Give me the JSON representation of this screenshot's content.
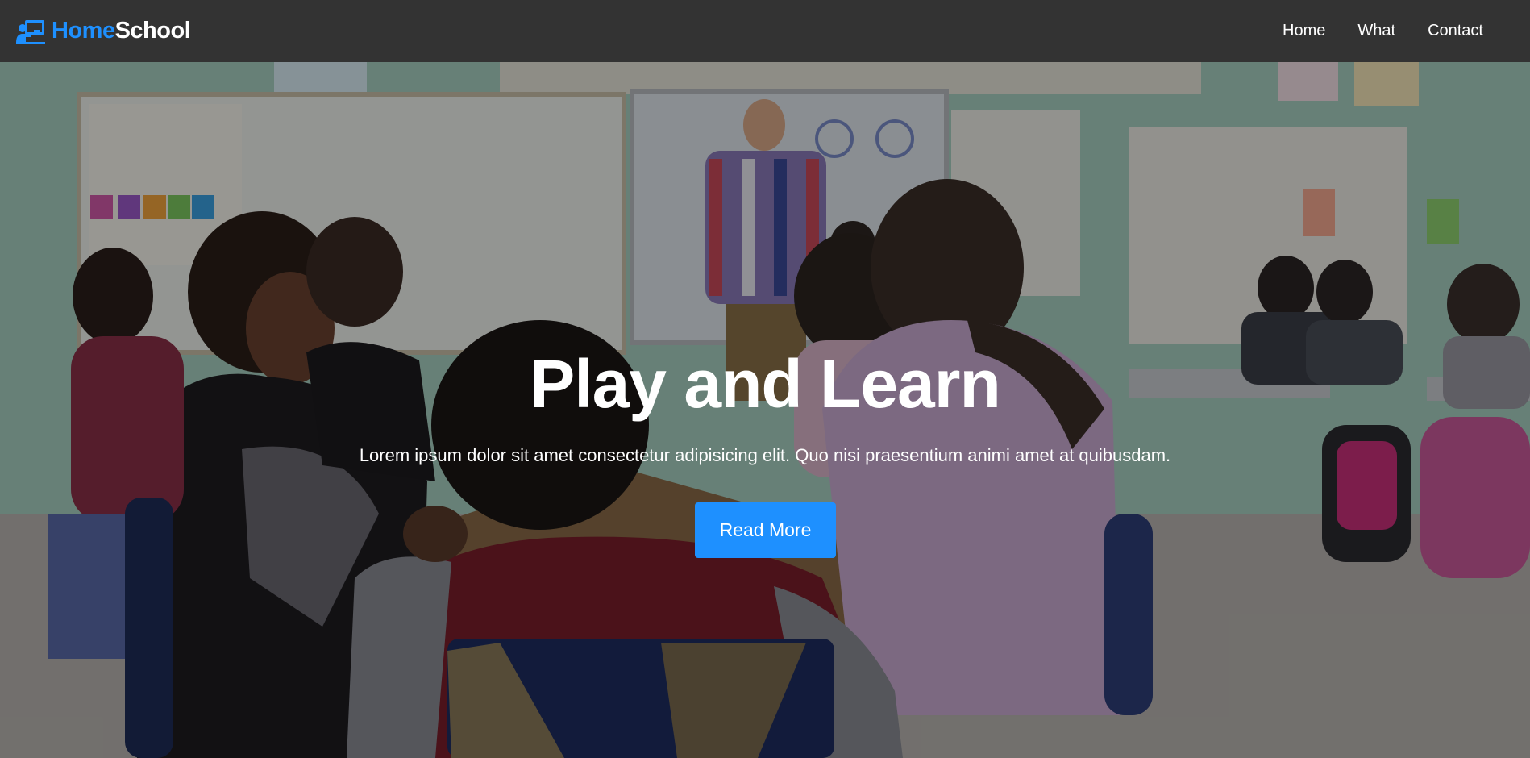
{
  "brand": {
    "part1": "Home",
    "part2": "School",
    "accent_color": "#1e90ff",
    "icon": "teacher-board-icon"
  },
  "nav": {
    "items": [
      {
        "label": "Home"
      },
      {
        "label": "What"
      },
      {
        "label": "Contact"
      }
    ]
  },
  "hero": {
    "title": "Play and Learn",
    "text": "Lorem ipsum dolor sit amet consectetur adipisicing elit. Quo nisi praesentium animi amet at quibusdam.",
    "button_label": "Read More",
    "background": "classroom photo with teacher and students"
  },
  "colors": {
    "navbar": "#333333",
    "accent": "#1e90ff"
  }
}
